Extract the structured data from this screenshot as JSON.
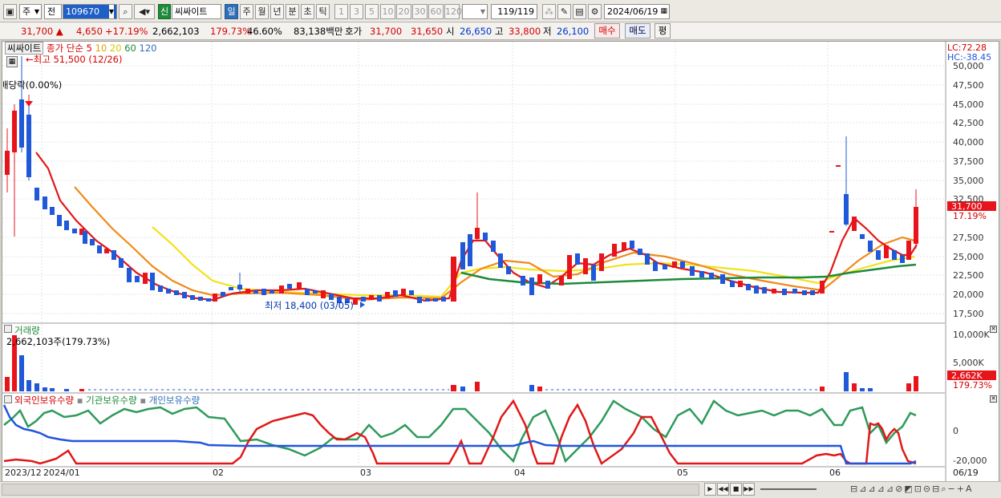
{
  "toolbar": {
    "kind_1": "주",
    "kind_2": "전",
    "code": "109670",
    "new_badge": "신",
    "stock_name": "씨싸이트",
    "periods": [
      "일",
      "주",
      "월",
      "년",
      "분",
      "초",
      "틱"
    ],
    "active_period": "일",
    "nums": [
      "1",
      "3",
      "5",
      "10",
      "20",
      "30",
      "60",
      "120"
    ],
    "page": "119",
    "page_total": "/119",
    "date": "2024/06/19"
  },
  "quote": {
    "price": "31,700 ▲",
    "change": "4,650",
    "rate": "+17.19%",
    "volume": "2,662,103",
    "vol_ratio": "179.73%",
    "turnover": "46.60%",
    "amount": "83,138백만",
    "ask_label": "호가",
    "ask1": "31,700",
    "ask2": "31,650",
    "open_label": "시",
    "open": "26,650",
    "high_label": "고",
    "high": "33,800",
    "low_label": "저",
    "low": "26,100",
    "buy": "매수",
    "sell": "매도",
    "eval": "평"
  },
  "price_panel": {
    "name_tab": "씨싸이트",
    "legend_label": "종가 단순",
    "ma": [
      "5",
      "10",
      "20",
      "60",
      "120"
    ],
    "high_note": "최고 51,500 (12/26)",
    "low_note": "최저 18,400 (03/05)",
    "dividend": "배당락(0.00%)",
    "lc": "LC:72.28",
    "hc": "HC:-38.45",
    "price_tag": "31,700",
    "rate_tag": "17.19%",
    "y_ticks": [
      "50,000",
      "47,500",
      "45,000",
      "42,500",
      "40,000",
      "37,500",
      "35,000",
      "32,500",
      "30,000",
      "27,500",
      "25,000",
      "22,500",
      "20,000",
      "17,500"
    ]
  },
  "volume_panel": {
    "title": "거래량",
    "value": "2,662,103주(179.73%)",
    "y_ticks": [
      "10,000K",
      "5,000K"
    ],
    "vol_tag": "2,662K",
    "ratio_tag": "179.73%"
  },
  "holdings_panel": {
    "legend": [
      "외국인보유수량",
      "기관보유수량",
      "개인보유수량"
    ],
    "y_ticks": [
      "0",
      "-20,000"
    ]
  },
  "x_axis": [
    "2023/12",
    "2024/01",
    "02",
    "03",
    "04",
    "05",
    "06",
    "06/19"
  ],
  "colors": {
    "up": "#e8141c",
    "down": "#1f58d8",
    "ma5": "#e01818",
    "ma10": "#f08a1a",
    "ma20": "#f2e21a",
    "ma60": "#1e8a3a",
    "blue_line": "#2255dd",
    "green_line": "#2e9a5a"
  }
}
